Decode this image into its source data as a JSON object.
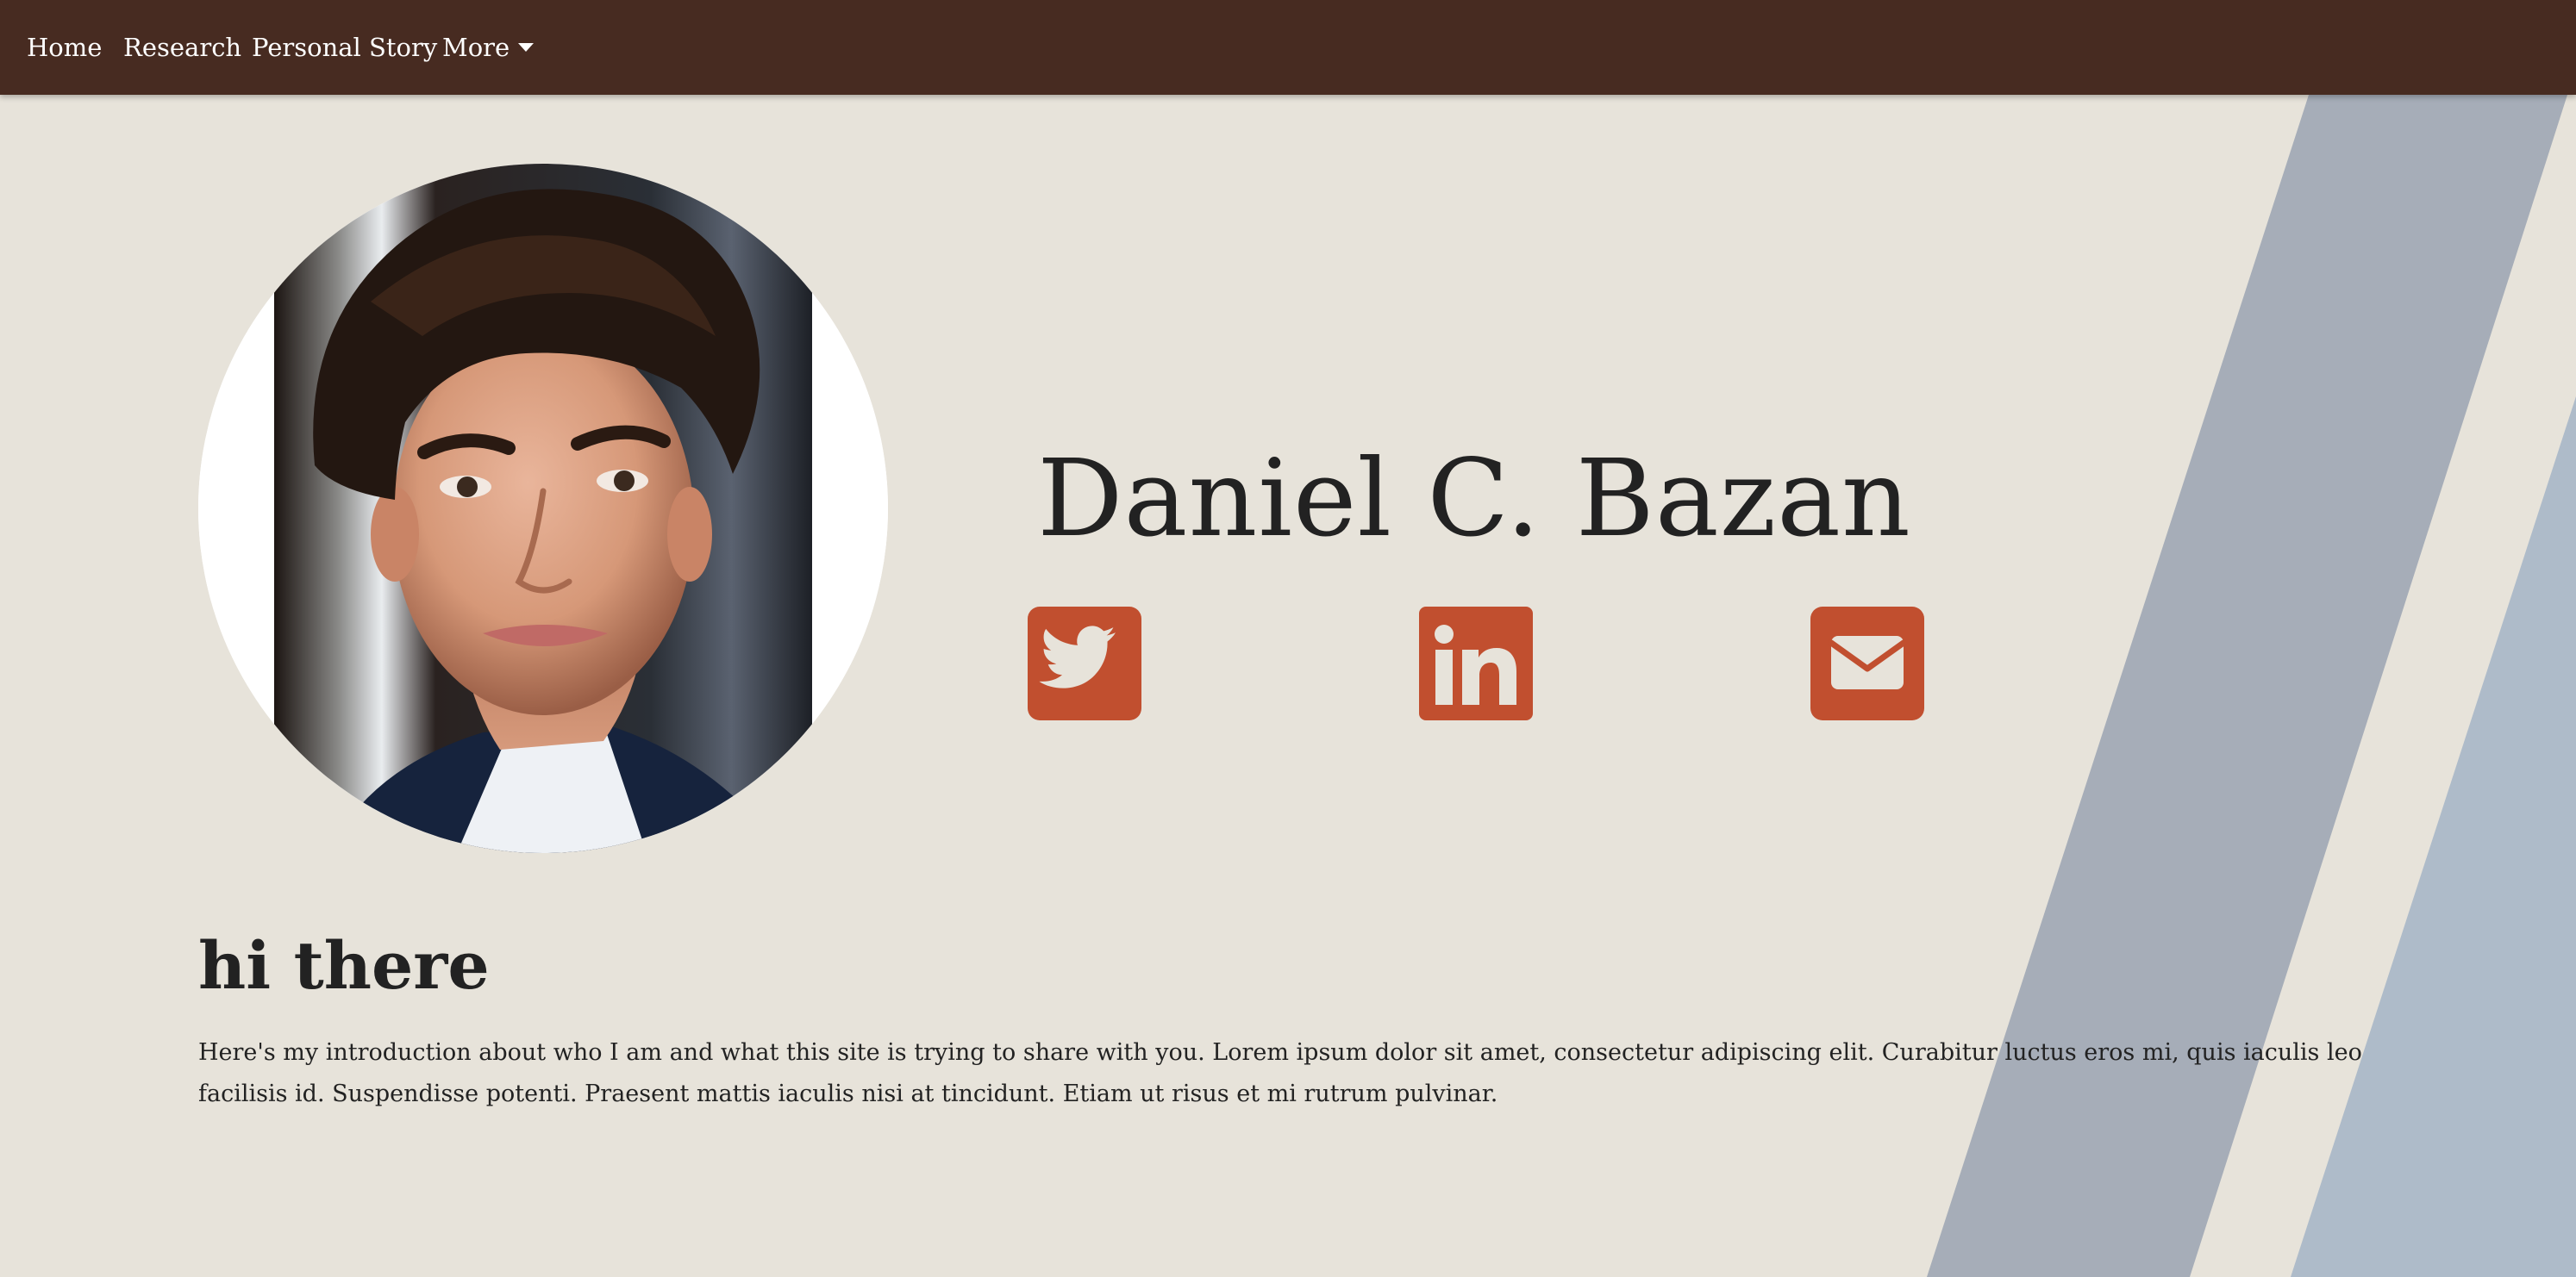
{
  "nav": {
    "items": [
      {
        "label": "Home"
      },
      {
        "label": "Research"
      },
      {
        "label": "Personal Story"
      },
      {
        "label": "More"
      }
    ]
  },
  "profile": {
    "name": "Daniel C. Bazan",
    "photo_alt": "Portrait of Daniel C. Bazan"
  },
  "social": [
    {
      "icon": "twitter-icon"
    },
    {
      "icon": "linkedin-icon"
    },
    {
      "icon": "email-icon"
    }
  ],
  "intro": {
    "heading": "hi there",
    "text": "Here's my introduction about who I am and what this site is trying to share with you. Lorem ipsum dolor sit amet, consectetur adipiscing elit. Curabitur luctus eros mi, quis iaculis leo facilisis id. Suspendisse potenti. Praesent mattis iaculis nisi at tincidunt. Etiam ut risus et mi rutrum pulvinar."
  },
  "colors": {
    "navbar": "#472b21",
    "background": "#e7e3da",
    "accent": "#c14f2f",
    "stripe_1": "#a6adb8",
    "stripe_2": "#aebbc9",
    "text": "#222222"
  }
}
